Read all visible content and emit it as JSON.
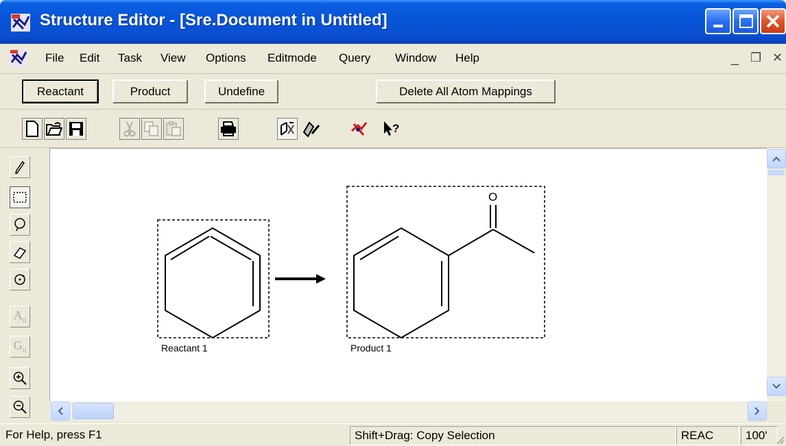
{
  "window": {
    "title": "Structure Editor - [Sre.Document in Untitled]"
  },
  "menu": {
    "items": [
      "File",
      "Edit",
      "Task",
      "View",
      "Options",
      "Editmode",
      "Query",
      "Window",
      "Help"
    ]
  },
  "buttons": {
    "reactant": "Reactant",
    "product": "Product",
    "undefine": "Undefine",
    "delete_mappings": "Delete All Atom Mappings"
  },
  "toolbar": {
    "icons": [
      "new-icon",
      "open-icon",
      "save-icon",
      "cut-icon",
      "copy-icon",
      "paste-icon",
      "print-icon",
      "structure-mode-icon",
      "reaction-mode-icon",
      "marvin-icon",
      "context-help-icon"
    ]
  },
  "palette": {
    "tools": [
      "pencil-icon",
      "select-rect-icon",
      "lasso-icon",
      "eraser-icon",
      "rotate-icon",
      "atom-label-icon",
      "group-label-icon",
      "zoom-in-icon",
      "zoom-out-icon"
    ],
    "atom_label": "A",
    "atom_sub": "n",
    "group_label": "G",
    "group_sub": "n"
  },
  "canvas": {
    "reactant_label": "Reactant 1",
    "product_label": "Product 1",
    "oxygen_label": "O"
  },
  "status": {
    "help": "For Help, press F1",
    "hint": "Shift+Drag: Copy Selection",
    "mode": "REAC",
    "zoom": "100'"
  }
}
